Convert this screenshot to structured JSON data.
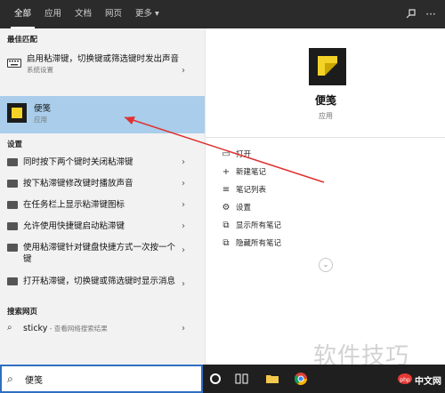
{
  "header": {
    "tabs": [
      {
        "label": "全部",
        "active": true
      },
      {
        "label": "应用"
      },
      {
        "label": "文档"
      },
      {
        "label": "网页"
      },
      {
        "label": "更多 ▾"
      }
    ],
    "icons": [
      "feedback-icon",
      "more-options-icon"
    ]
  },
  "best_match": {
    "title": "最佳匹配",
    "items": [
      {
        "label": "启用粘滞键，切换键或筛选键时发出声音",
        "sub": "系统设置",
        "icon": "keyboard-icon"
      },
      {
        "label": "便笺",
        "sub": "应用",
        "icon": "sticky-notes-app-icon",
        "selected": true
      }
    ]
  },
  "settings": {
    "title": "设置",
    "items": [
      {
        "label": "同时按下两个键时关闭粘滞键"
      },
      {
        "label": "按下粘滞键修改键时播放声音"
      },
      {
        "label": "在任务栏上显示粘滞键图标"
      },
      {
        "label": "允许使用快捷键启动粘滞键"
      },
      {
        "label": "使用粘滞键针对键盘快捷方式一次按一个键"
      },
      {
        "label": "打开粘滞键，切换键或筛选键时显示消息"
      }
    ]
  },
  "web_search": {
    "title": "搜索网页",
    "query": "sticky",
    "sub": " - 查看网络搜索结果"
  },
  "preview": {
    "app_name": "便笺",
    "app_type": "应用",
    "actions": [
      {
        "label": "打开",
        "icon": "open-icon"
      },
      {
        "label": "新建笔记",
        "icon": "plus-icon"
      },
      {
        "label": "笔记列表",
        "icon": "list-icon"
      },
      {
        "label": "设置",
        "icon": "gear-icon"
      },
      {
        "label": "显示所有笔记",
        "icon": "show-notes-icon"
      },
      {
        "label": "隐藏所有笔记",
        "icon": "hide-notes-icon"
      }
    ]
  },
  "taskbar": {
    "search_value": "便笺"
  },
  "watermark": "软件技巧",
  "brand": "中文网",
  "colors": {
    "selected_bg": "#a9cdea",
    "header_bg": "#2b2b2b",
    "arrow": "#e03030",
    "note_yellow": "#f4d227"
  }
}
